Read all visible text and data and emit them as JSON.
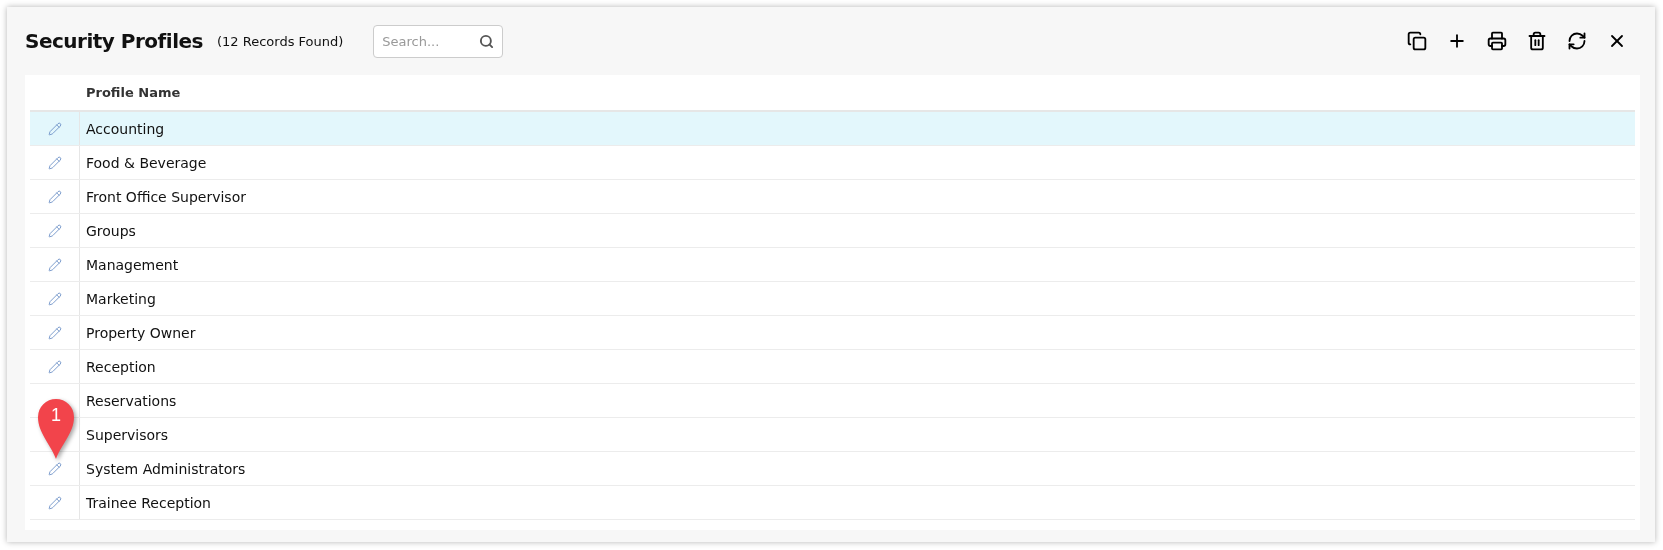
{
  "header": {
    "title": "Security Profiles",
    "count": "(12 Records Found)",
    "search": {
      "placeholder": "Search..."
    },
    "toolbar": [
      {
        "kind": "copy"
      },
      {
        "kind": "add"
      },
      {
        "kind": "print"
      },
      {
        "kind": "delete"
      },
      {
        "kind": "refresh"
      },
      {
        "kind": "close"
      }
    ]
  },
  "table": {
    "columns": [
      "Profile Name"
    ],
    "rows": [
      {
        "name": "Accounting",
        "selected": true,
        "edit_icon": true
      },
      {
        "name": "Food & Beverage",
        "selected": false,
        "edit_icon": true
      },
      {
        "name": "Front Office Supervisor",
        "selected": false,
        "edit_icon": true
      },
      {
        "name": "Groups",
        "selected": false,
        "edit_icon": true
      },
      {
        "name": "Management",
        "selected": false,
        "edit_icon": true
      },
      {
        "name": "Marketing",
        "selected": false,
        "edit_icon": true
      },
      {
        "name": "Property Owner",
        "selected": false,
        "edit_icon": true
      },
      {
        "name": "Reception",
        "selected": false,
        "edit_icon": true
      },
      {
        "name": "Reservations",
        "selected": false,
        "edit_icon": false
      },
      {
        "name": "Supervisors",
        "selected": false,
        "edit_icon": false
      },
      {
        "name": "System Administrators",
        "selected": false,
        "edit_icon": true
      },
      {
        "name": "Trainee Reception",
        "selected": false,
        "edit_icon": true
      }
    ]
  },
  "callout": {
    "label": "1"
  }
}
